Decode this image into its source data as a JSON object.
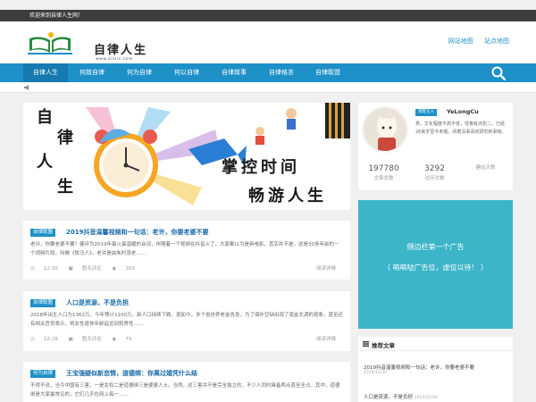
{
  "topbar": {
    "welcome": "欢迎来到自律人生网！"
  },
  "header": {
    "logo_title": "自律人生",
    "logo_sub": "www.zilvrs.com",
    "links": [
      "网站地图",
      "站点地图"
    ]
  },
  "nav": {
    "items": [
      "自律人生",
      "何故自律",
      "何为自律",
      "何以自律",
      "自律故事",
      "自律格言",
      "自律联盟"
    ],
    "active_index": 0
  },
  "banner": {
    "chars_left": [
      "自",
      "律",
      "人",
      "生"
    ],
    "line1": "掌控时间",
    "line2": "畅游人生"
  },
  "posts": [
    {
      "category": "自律联盟",
      "title": "2019抖音温馨视频和一句话：老许，你要老婆不要",
      "excerpt": "老许，你要老婆不要？健评为2019年最火最温暖的台词，伴随着一个视频在抖音火了，大家都以为是新电影，其实并不是。这是30多年前的一个视频片段，叫做《牧马人》，老许是由朱时茂老……",
      "date": "12-30",
      "comments": "暂无评论",
      "views": "203",
      "more": "阅读详情"
    },
    {
      "category": "自律联盟",
      "title": "人口是资源，不是负担",
      "excerpt": "2018年出生人口为1362万，今年预计1100万，新人口持续下跌。现如今，多个省份养老金告急，为了填补空缺出现了南金北调的现象，甚至还有相关官员表示，将女性退休年龄延迟到和男性……",
      "date": "12-28",
      "comments": "暂无评论",
      "views": "79",
      "more": "阅读详情"
    },
    {
      "category": "何为自律",
      "title": "王宝强疑似新恋情，道德绑：你离过婚凭什么结",
      "excerpt": "不得不说，当今中国有三害，一是女权二是道德绑三是婆婆人士。当然，这三害并不是完全独立的，不少人同时具备两点甚至全占。其中，道德绑是大家最常见的，它们几乎在网上每一……",
      "date": "",
      "comments": "",
      "views": "",
      "more": ""
    }
  ],
  "profile": {
    "role": "博客主人",
    "username": "YeLongCu",
    "bio": "男，文化程度不高不低，性格有点犯二，已经26来岁至今未婚，闲着没事喜欢研究新事物。",
    "stats": [
      {
        "value": "197780",
        "label": "文章总数"
      },
      {
        "value": "3292",
        "label": "访问次数"
      },
      {
        "value": "",
        "label": "建站天数"
      }
    ]
  },
  "ad": {
    "line1": "侧边栏第一个广告",
    "line2": "（ 萌萌哒广告位，虚位以待！ ）"
  },
  "recommend": {
    "title": "推荐文章",
    "items": [
      {
        "title": "2019抖音温馨视频和一句话：老许，你要老婆不要",
        "date": "2019/12/30"
      },
      {
        "title": "人口是资源，不是负担",
        "date": "2019/12/28"
      }
    ]
  },
  "colors": {
    "brand": "#1e90c8",
    "ad_bg": "#3cb5c9",
    "topbar": "#3d3d3d"
  }
}
